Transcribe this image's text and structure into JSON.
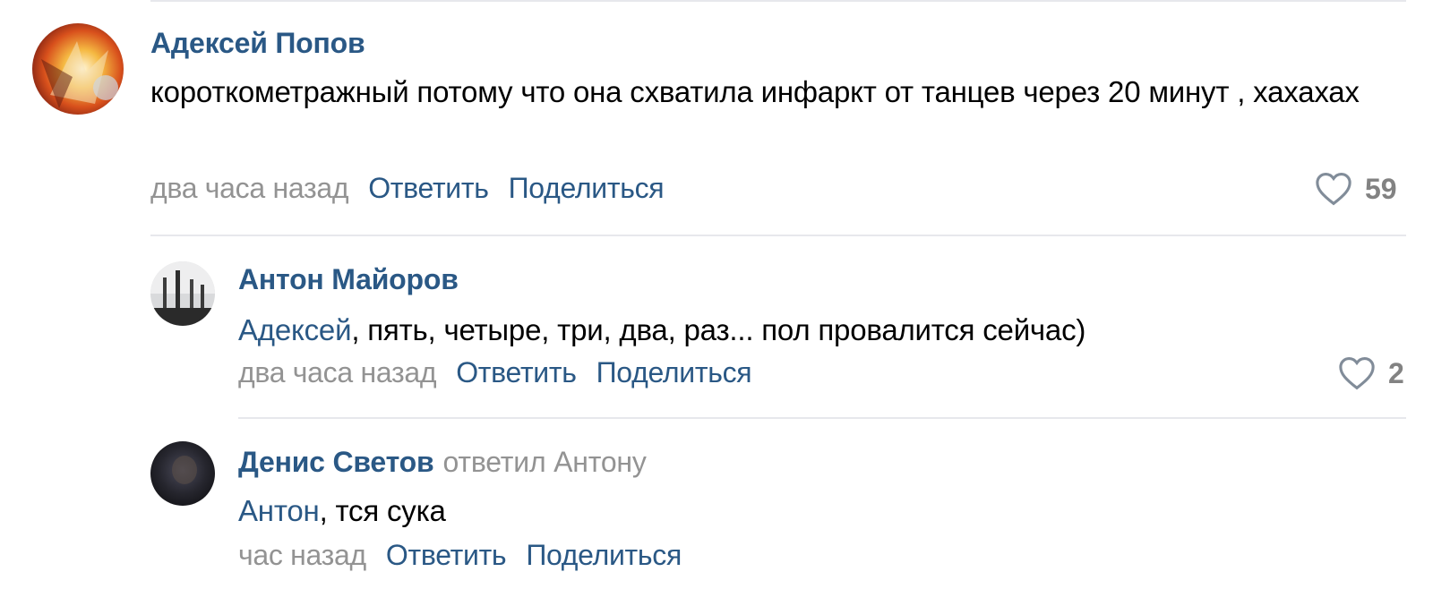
{
  "comments": [
    {
      "author": "Адексей Попов",
      "text": "короткометражный потому что она схватила инфаркт от танцев через 20 минут , хахахах",
      "time": "два часа назад",
      "reply_label": "Ответить",
      "share_label": "Поделиться",
      "likes": "59",
      "avatar_icon": "user-avatar-orange-abstract"
    },
    {
      "author": "Антон Майоров",
      "mention": "Адексей",
      "text": ", пять, четыре, три, два, раз... пол провалится сейчас)",
      "time": "два часа назад",
      "reply_label": "Ответить",
      "share_label": "Поделиться",
      "likes": "2",
      "avatar_icon": "user-avatar-grey-photo"
    },
    {
      "author": "Денис Светов",
      "replied_to": "ответил Антону",
      "mention": "Антон",
      "text": ", тся сука",
      "time": "час назад",
      "reply_label": "Ответить",
      "share_label": "Поделиться",
      "avatar_icon": "user-avatar-dark-photo"
    }
  ],
  "colors": {
    "link": "#2a5885",
    "muted": "#939393",
    "divider": "#e7e8ec",
    "like_count": "#828282"
  }
}
